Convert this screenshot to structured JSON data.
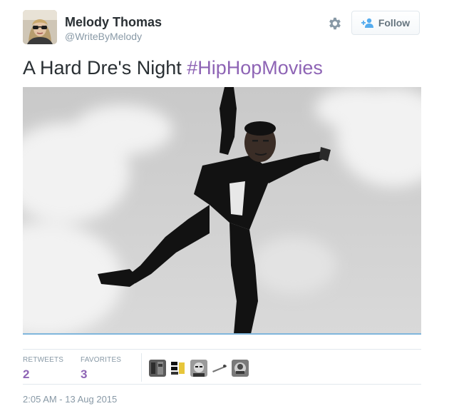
{
  "author": {
    "name": "Melody Thomas",
    "handle": "@WriteByMelody",
    "avatar_icon": "profile-photo"
  },
  "actions": {
    "settings_icon": "gear-icon",
    "follow_label": "Follow",
    "follow_icon": "add-user-icon"
  },
  "tweet": {
    "text": "A Hard Dre's Night ",
    "hashtag": "#HipHopMovies"
  },
  "stats": {
    "retweets_label": "RETWEETS",
    "retweets_count": "2",
    "favorites_label": "FAVORITES",
    "favorites_count": "3"
  },
  "timestamp": "2:05 AM - 13 Aug 2015",
  "colors": {
    "hashtag": "#8e64b5",
    "muted": "#8899a6",
    "text": "#292f33",
    "media_underline": "#7fb6dc"
  }
}
